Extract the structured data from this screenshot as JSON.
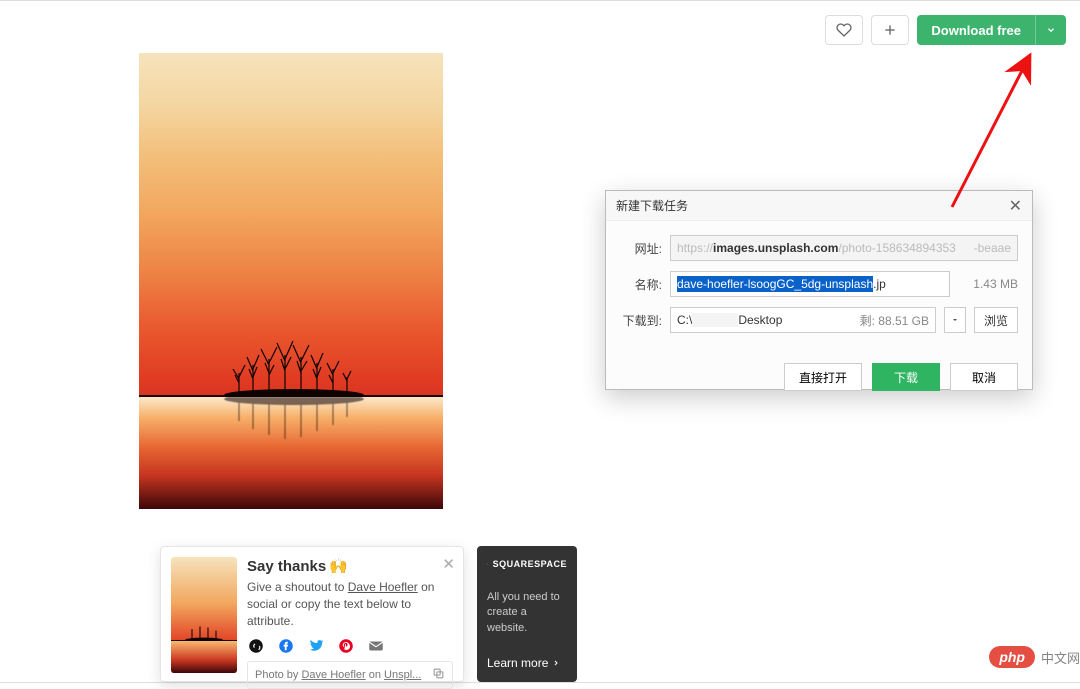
{
  "top": {
    "download_label": "Download free"
  },
  "thanks": {
    "title": "Say thanks",
    "line_pre": "Give a shoutout to ",
    "author": "Dave Hoefler",
    "line_mid": " on social or copy the text below to attribute.",
    "attrib_pre": "Photo by ",
    "attrib_author": "Dave Hoefler",
    "attrib_mid": " on ",
    "attrib_site": "Unspl..."
  },
  "squarespace": {
    "brand": "SQUARESPACE",
    "tag": "All you need to create a website.",
    "learn": "Learn more"
  },
  "dialog": {
    "title": "新建下载任务",
    "label_url": "网址:",
    "url_scheme": "https://",
    "url_host": "images.unsplash.com",
    "url_rest": "/photo-158634894353",
    "url_tail": "-beaae",
    "label_name": "名称:",
    "filename_sel": "dave-hoefler-lsoogGC_5dg-unsplash",
    "filename_ext": ".jp",
    "filesize": "1.43 MB",
    "label_dest": "下载到:",
    "dest_prefix": "C:\\",
    "dest_suffix": "Desktop",
    "dest_free_label": "剩:",
    "dest_free": "88.51 GB",
    "browse": "浏览",
    "open_direct": "直接打开",
    "download": "下载",
    "cancel": "取消"
  },
  "badge": {
    "pill": "php",
    "site": "中文网"
  }
}
